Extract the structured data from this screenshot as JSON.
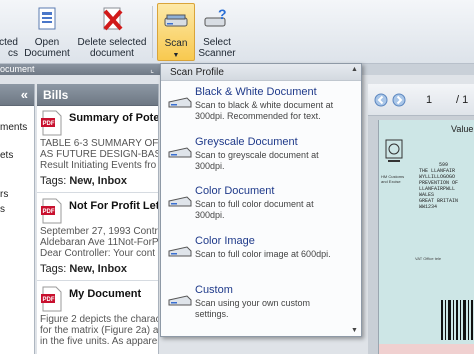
{
  "ribbon": {
    "partial_left_label_1": "cted",
    "partial_left_label_2": "cs",
    "open_document": {
      "line1": "Open",
      "line2": "Document"
    },
    "delete_selected": {
      "line1": "Delete selected",
      "line2": "document"
    },
    "scan": {
      "line1": "Scan"
    },
    "select_scanner": {
      "line1": "Select",
      "line2": "Scanner"
    },
    "group_label": "ocument"
  },
  "left_pane": {
    "chevron": "«",
    "items": [
      "ments",
      "ets",
      "rs",
      "s"
    ]
  },
  "bills": {
    "header": "Bills",
    "documents": [
      {
        "title": "Summary of Potent",
        "desc": [
          "TABLE 6-3 SUMMARY OF P",
          "AS FUTURE DESIGN-BASIS",
          "Result Initiating Events fro"
        ],
        "tags_label": "Tags:",
        "tags": "New, Inbox"
      },
      {
        "title": "Not For Profit Lette",
        "desc": [
          "September 27, 1993 Contr",
          "Aldebaran Ave 11Not-ForP",
          "Dear Controller: Your cont"
        ],
        "tags_label": "Tags:",
        "tags": "New, Inbox"
      },
      {
        "title": "My Document",
        "desc": [
          "Figure 2 depicts the charact",
          "for the matrix (Figure 2a) an",
          "in the five units. As apparen"
        ]
      }
    ]
  },
  "viewer": {
    "page_number": "1",
    "page_total": "/ 1",
    "doc_text": {
      "value_label": "Value A",
      "lines": [
        "599",
        "THE LLANFAIR",
        "WYLLILLOGOGO",
        "PREVENTION OF",
        "LLANFAIRPWLL",
        "WALES",
        "GREAT BRITAIN",
        "WW1234"
      ],
      "vat_text": "VAT Office tele",
      "customs_text": "HM Customs and Excise"
    }
  },
  "menu": {
    "header": "Scan Profile",
    "options": [
      {
        "title": "Black & White Document",
        "desc": [
          "Scan to black & white document at",
          "300dpi. Recommended for text."
        ]
      },
      {
        "title": "Greyscale Document",
        "desc": [
          "Scan to greyscale document at",
          "300dpi."
        ]
      },
      {
        "title": "Color Document",
        "desc": [
          "Scan to full color document at",
          "300dpi."
        ]
      },
      {
        "title": "Color Image",
        "desc": [
          "Scan to full color image at 600dpi."
        ]
      },
      {
        "title": "Custom",
        "desc": [
          "Scan using your own custom",
          "settings."
        ]
      }
    ]
  },
  "colors": {
    "accent_active": "#f8c94f",
    "option_title": "#1f3a8a",
    "pane_header": "#7a8490"
  }
}
